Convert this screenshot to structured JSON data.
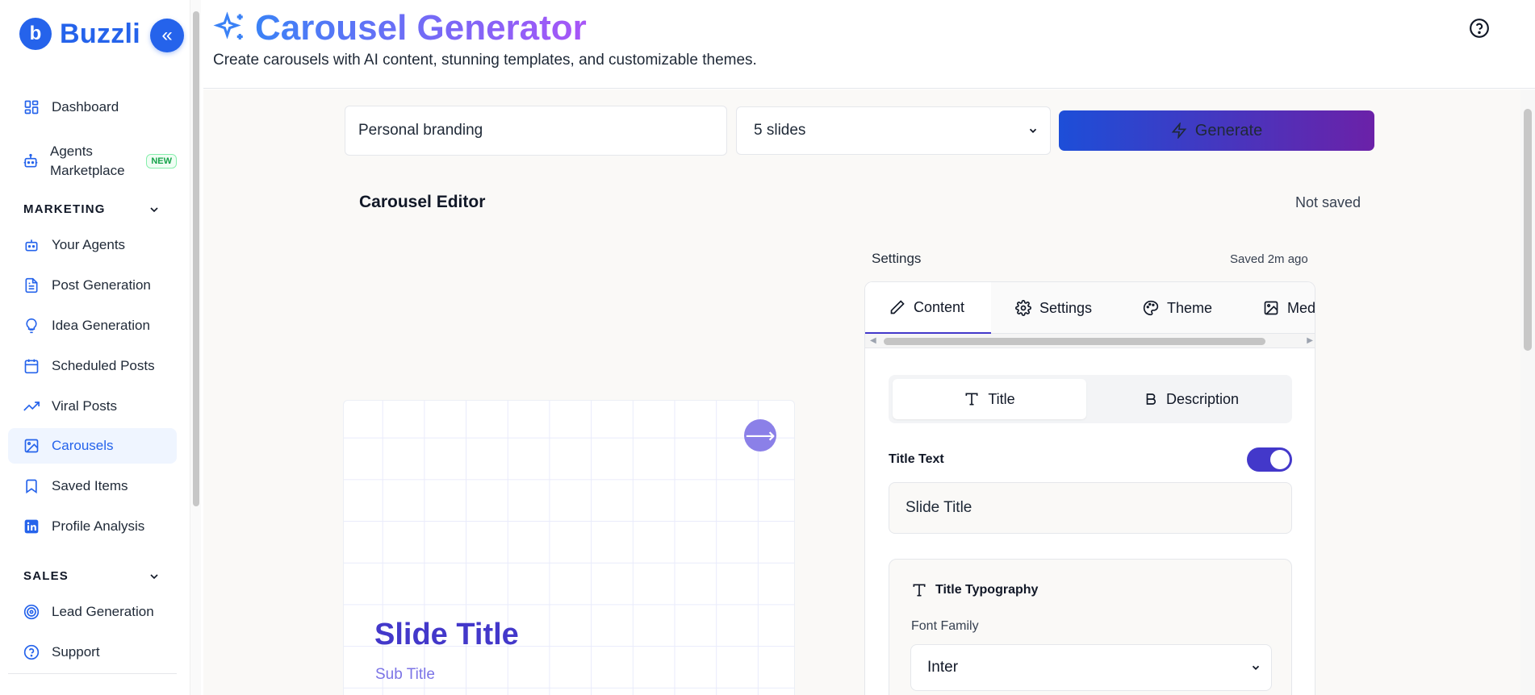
{
  "brand": {
    "name": "Buzzli",
    "logo_letter": "b",
    "collapse_icon": "«"
  },
  "sidebar": {
    "items": [
      {
        "label": "Dashboard",
        "icon": "dashboard-icon"
      },
      {
        "label": "Agents Marketplace",
        "icon": "robot-icon",
        "badge": "NEW"
      }
    ],
    "sections": [
      {
        "title": "MARKETING",
        "items": [
          {
            "label": "Your Agents",
            "icon": "robot-icon"
          },
          {
            "label": "Post Generation",
            "icon": "document-icon"
          },
          {
            "label": "Idea Generation",
            "icon": "lightbulb-icon"
          },
          {
            "label": "Scheduled Posts",
            "icon": "calendar-icon"
          },
          {
            "label": "Viral Posts",
            "icon": "trending-icon"
          },
          {
            "label": "Carousels",
            "icon": "image-icon",
            "active": true
          },
          {
            "label": "Saved Items",
            "icon": "bookmark-icon"
          },
          {
            "label": "Profile Analysis",
            "icon": "linkedin-icon"
          }
        ]
      },
      {
        "title": "SALES",
        "items": [
          {
            "label": "Lead Generation",
            "icon": "target-icon"
          },
          {
            "label": "Support",
            "icon": "help-icon"
          }
        ]
      }
    ]
  },
  "header": {
    "title": "Carousel Generator",
    "subtitle": "Create carousels with AI content, stunning templates, and customizable themes."
  },
  "generator": {
    "topic_value": "Personal branding",
    "slides_value": "5 slides",
    "generate_label": "Generate"
  },
  "editor": {
    "title": "Carousel Editor",
    "save_status": "Not saved"
  },
  "preview": {
    "title": "Slide Title",
    "subtitle": "Sub Title",
    "arrow": "⟶"
  },
  "settings": {
    "label": "Settings",
    "saved": "Saved 2m ago",
    "tabs": [
      {
        "label": "Content",
        "icon": "pencil-icon",
        "active": true
      },
      {
        "label": "Settings",
        "icon": "gear-icon"
      },
      {
        "label": "Theme",
        "icon": "palette-icon"
      },
      {
        "label": "Med",
        "icon": "image-icon"
      }
    ],
    "segments": [
      {
        "label": "Title",
        "icon": "text-icon",
        "active": true
      },
      {
        "label": "Description",
        "icon": "bold-icon"
      }
    ],
    "title_text_label": "Title Text",
    "title_toggle_on": true,
    "title_value": "Slide Title",
    "typography_header": "Title Typography",
    "font_family_label": "Font Family",
    "font_family_value": "Inter"
  },
  "colors": {
    "primary": "#2563eb",
    "accent": "#4338ca",
    "gradient_start": "#1d4ed8",
    "gradient_end": "#6b21a8"
  }
}
